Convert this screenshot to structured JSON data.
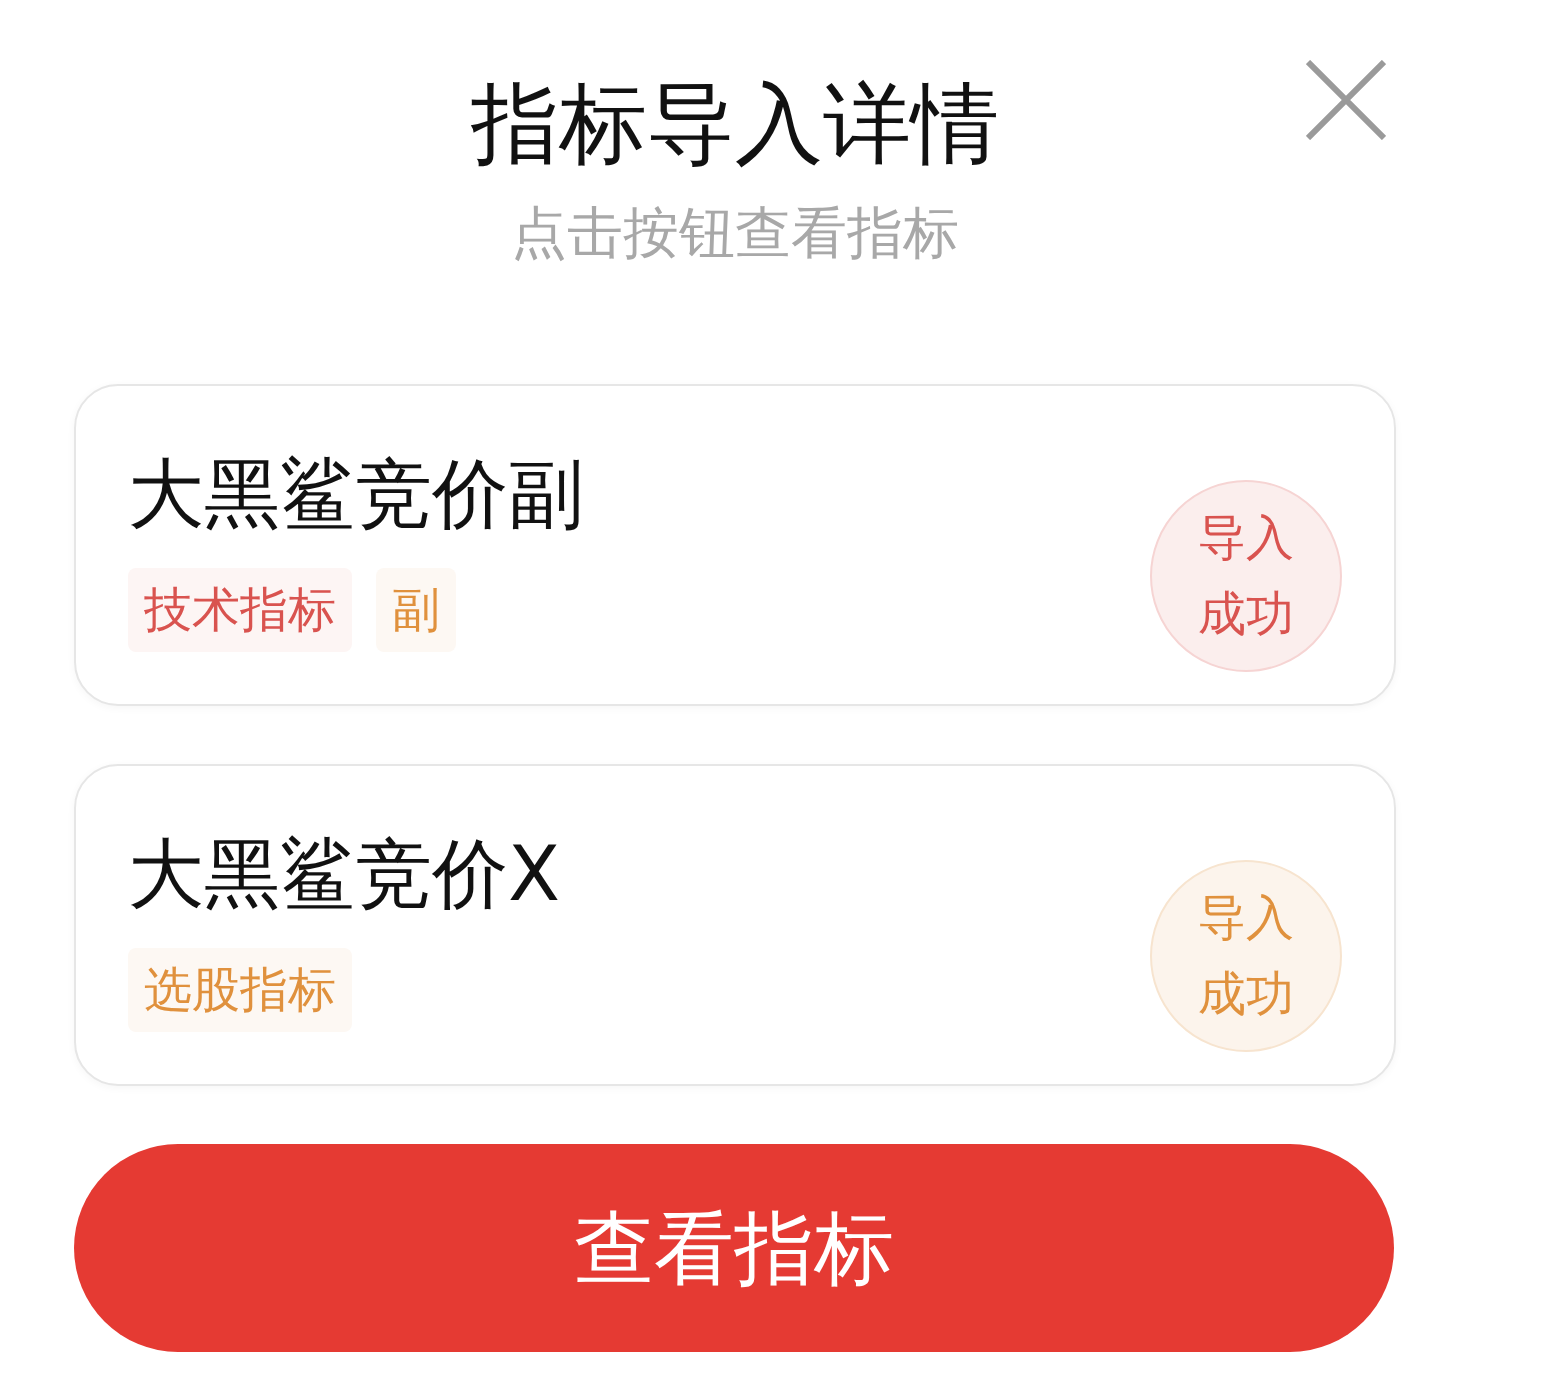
{
  "dialog": {
    "title": "指标导入详情",
    "subtitle": "点击按钮查看指标"
  },
  "indicators": [
    {
      "name": "大黑鲨竞价副",
      "tags": [
        {
          "label": "技术指标",
          "color": "#d9534f"
        },
        {
          "label": "副",
          "color": "#e0913d"
        }
      ],
      "status": {
        "label": "导入成功",
        "color": "#d9534f"
      }
    },
    {
      "name": "大黑鲨竞价X",
      "tags": [
        {
          "label": "选股指标",
          "color": "#e0913d"
        }
      ],
      "status": {
        "label": "导入成功",
        "color": "#e0913d"
      }
    }
  ],
  "primary_button": {
    "label": "查看指标"
  }
}
